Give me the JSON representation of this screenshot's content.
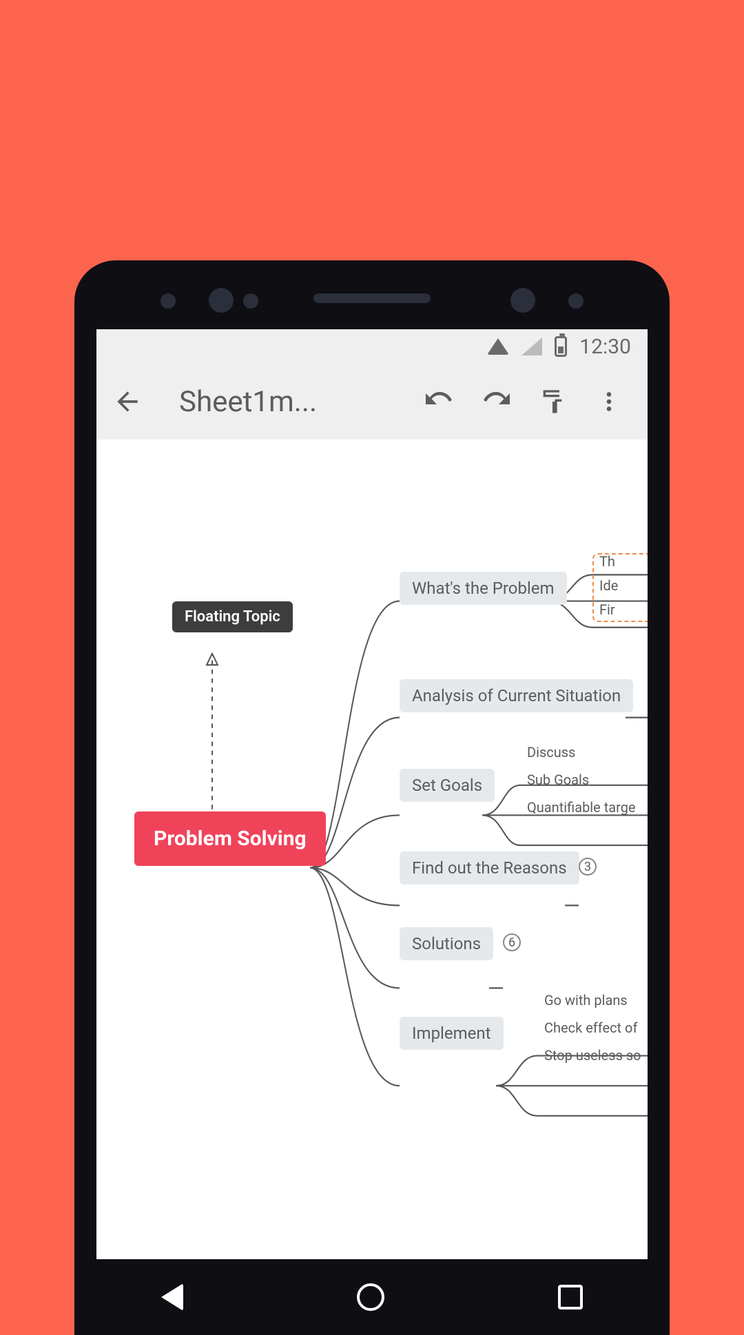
{
  "status": {
    "time": "12:30"
  },
  "appbar": {
    "title": "Sheet1m..."
  },
  "mindmap": {
    "root": "Problem Solving",
    "floating": "Floating Topic",
    "branches": [
      {
        "label": "What's the Problem",
        "leaves": [
          "Th",
          "Ide",
          "Fir"
        ],
        "highlighted": true
      },
      {
        "label": "Analysis of Current Situation",
        "leaves": []
      },
      {
        "label": "Set Goals",
        "leaves": [
          "Discuss",
          "Sub Goals",
          "Quantifiable targe"
        ]
      },
      {
        "label": "Find out the Reasons",
        "badge": "3"
      },
      {
        "label": "Solutions",
        "badge": "6"
      },
      {
        "label": "Implement",
        "leaves": [
          "Go with plans",
          "Check effect of",
          "Stop useless so"
        ]
      }
    ]
  }
}
